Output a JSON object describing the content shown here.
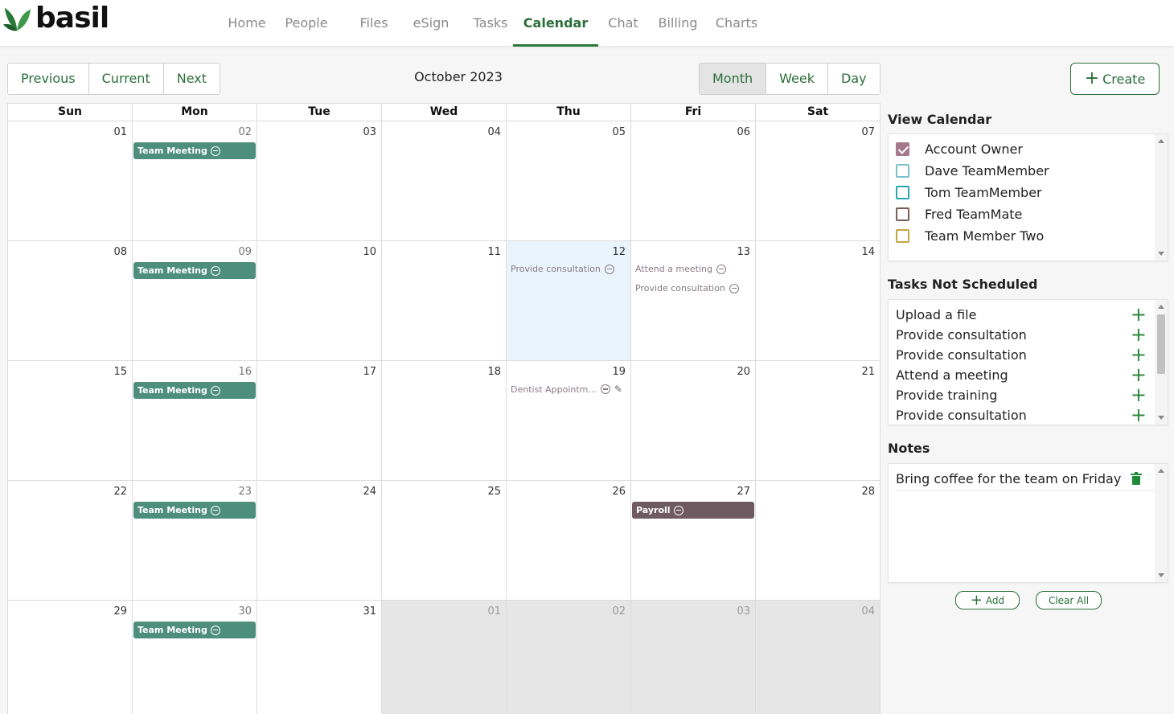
{
  "app": {
    "brand": "basil",
    "brand_color": "#2b6e3a"
  },
  "nav": [
    {
      "label": "Home",
      "active": false
    },
    {
      "label": "People",
      "active": false
    },
    {
      "label": "Files",
      "active": false
    },
    {
      "label": "eSign",
      "active": false
    },
    {
      "label": "Tasks",
      "active": false
    },
    {
      "label": "Calendar",
      "active": true
    },
    {
      "label": "Chat",
      "active": false
    },
    {
      "label": "Billing",
      "active": false
    },
    {
      "label": "Charts",
      "active": false
    }
  ],
  "toolbar": {
    "previous": "Previous",
    "current": "Current",
    "next": "Next",
    "month_title": "October 2023",
    "views": [
      {
        "label": "Month",
        "active": true
      },
      {
        "label": "Week",
        "active": false
      },
      {
        "label": "Day",
        "active": false
      }
    ],
    "create": "Create"
  },
  "calendar": {
    "weekdays": [
      "Sun",
      "Mon",
      "Tue",
      "Wed",
      "Thu",
      "Fri",
      "Sat"
    ],
    "weeks": [
      [
        {
          "num": "01"
        },
        {
          "num": "02",
          "muted": true,
          "events": [
            {
              "label": "Team Meeting",
              "style": "block"
            }
          ]
        },
        {
          "num": "03"
        },
        {
          "num": "04"
        },
        {
          "num": "05"
        },
        {
          "num": "06"
        },
        {
          "num": "07"
        }
      ],
      [
        {
          "num": "08"
        },
        {
          "num": "09",
          "muted": true,
          "events": [
            {
              "label": "Team Meeting",
              "style": "block"
            }
          ]
        },
        {
          "num": "10"
        },
        {
          "num": "11"
        },
        {
          "num": "12",
          "today": true,
          "events": [
            {
              "label": "Provide consultation",
              "style": "text"
            }
          ]
        },
        {
          "num": "13",
          "events": [
            {
              "label": "Attend a meeting",
              "style": "text"
            },
            {
              "label": "Provide consultation",
              "style": "text"
            }
          ]
        },
        {
          "num": "14"
        }
      ],
      [
        {
          "num": "15"
        },
        {
          "num": "16",
          "muted": true,
          "events": [
            {
              "label": "Team Meeting",
              "style": "block"
            }
          ]
        },
        {
          "num": "17"
        },
        {
          "num": "18"
        },
        {
          "num": "19",
          "events": [
            {
              "label": "Dentist Appointm...",
              "style": "text",
              "editable": true
            }
          ]
        },
        {
          "num": "20"
        },
        {
          "num": "21"
        }
      ],
      [
        {
          "num": "22"
        },
        {
          "num": "23",
          "muted": true,
          "events": [
            {
              "label": "Team Meeting",
              "style": "block"
            }
          ]
        },
        {
          "num": "24"
        },
        {
          "num": "25"
        },
        {
          "num": "26"
        },
        {
          "num": "27",
          "events": [
            {
              "label": "Payroll",
              "style": "payroll"
            }
          ]
        },
        {
          "num": "28"
        }
      ],
      [
        {
          "num": "29"
        },
        {
          "num": "30",
          "muted": true,
          "events": [
            {
              "label": "Team Meeting",
              "style": "block"
            }
          ]
        },
        {
          "num": "31"
        },
        {
          "num": "01",
          "other": true
        },
        {
          "num": "02",
          "other": true
        },
        {
          "num": "03",
          "other": true
        },
        {
          "num": "04",
          "other": true
        }
      ]
    ]
  },
  "view_calendar": {
    "title": "View Calendar",
    "people": [
      {
        "name": "Account Owner",
        "color": "#a5788c",
        "checked": true
      },
      {
        "name": "Dave TeamMember",
        "color": "#7ac3c9",
        "checked": false
      },
      {
        "name": "Tom TeamMember",
        "color": "#2aa7b0",
        "checked": false
      },
      {
        "name": "Fred TeamMate",
        "color": "#7a5d55",
        "checked": false
      },
      {
        "name": "Team Member Two",
        "color": "#c9a348",
        "checked": false
      }
    ]
  },
  "tasks_not_scheduled": {
    "title": "Tasks Not Scheduled",
    "items": [
      "Upload a file",
      "Provide consultation",
      "Provide consultation",
      "Attend a meeting",
      "Provide training",
      "Provide consultation"
    ]
  },
  "notes": {
    "title": "Notes",
    "items": [
      "Bring coffee for the team on Friday"
    ],
    "add": "Add",
    "clear": "Clear All"
  }
}
